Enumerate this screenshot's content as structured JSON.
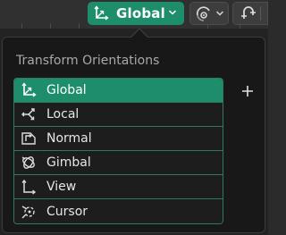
{
  "header": {
    "orientation_button": {
      "label": "Global",
      "icon": "global-axes-icon",
      "accent": "#1e8d6b"
    },
    "pivot_button": {
      "icon": "pivot-point-icon"
    },
    "snap_button": {
      "icon": "magnet-snap-icon"
    }
  },
  "popup": {
    "title": "Transform Orientations",
    "add_icon": "plus-icon",
    "items": [
      {
        "label": "Global",
        "icon": "global-axes-icon",
        "selected": true
      },
      {
        "label": "Local",
        "icon": "local-axes-icon",
        "selected": false
      },
      {
        "label": "Normal",
        "icon": "normal-icon",
        "selected": false
      },
      {
        "label": "Gimbal",
        "icon": "gimbal-icon",
        "selected": false
      },
      {
        "label": "View",
        "icon": "view-axes-icon",
        "selected": false
      },
      {
        "label": "Cursor",
        "icon": "cursor-icon",
        "selected": false
      }
    ]
  }
}
